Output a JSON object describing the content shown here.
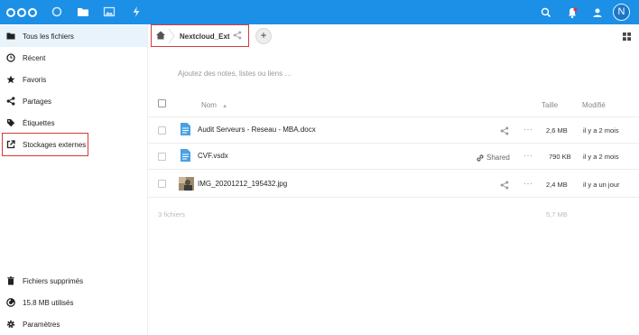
{
  "header": {
    "apps": [
      "dashboard-icon",
      "files-icon",
      "photos-icon",
      "activity-icon"
    ],
    "right_icons": [
      "search-icon",
      "notifications-icon",
      "contacts-icon"
    ],
    "avatar_initial": "N",
    "colors": {
      "bar": "#1c8fe6",
      "accent": "#0082c9",
      "highlight": "#d6393b"
    }
  },
  "sidebar": {
    "items": [
      {
        "label": "Tous les fichiers",
        "icon": "folder-icon",
        "active": true
      },
      {
        "label": "Récent",
        "icon": "clock-icon"
      },
      {
        "label": "Favoris",
        "icon": "star-icon"
      },
      {
        "label": "Partages",
        "icon": "share-icon"
      },
      {
        "label": "Étiquettes",
        "icon": "tag-icon"
      },
      {
        "label": "Stockages externes",
        "icon": "external-link-icon",
        "highlighted": true
      }
    ],
    "footer": [
      {
        "label": "Fichiers supprimés",
        "icon": "trash-icon"
      },
      {
        "label": "15.8 MB utilisés",
        "icon": "quota-pie-icon"
      },
      {
        "label": "Paramètres",
        "icon": "gear-icon"
      }
    ]
  },
  "breadcrumb": {
    "current": "Nextcloud_Ext"
  },
  "notes_placeholder": "Ajoutez des notes, listes ou liens …",
  "table": {
    "headers": {
      "name": "Nom",
      "size": "Taille",
      "modified": "Modifié"
    },
    "rows": [
      {
        "name": "Audit Serveurs - Reseau - MBA.docx",
        "type": "document",
        "shared": "",
        "size": "2,6 MB",
        "modified": "il y a 2 mois"
      },
      {
        "name": "CVF.vsdx",
        "type": "document",
        "shared": "Shared",
        "size": "790 KB",
        "modified": "il y a 2 mois"
      },
      {
        "name": "IMG_20201212_195432.jpg",
        "type": "image",
        "shared": "",
        "size": "2,4 MB",
        "modified": "il y a un jour"
      }
    ],
    "summary": {
      "count": "3 fichiers",
      "total": "5,7 MB"
    }
  }
}
